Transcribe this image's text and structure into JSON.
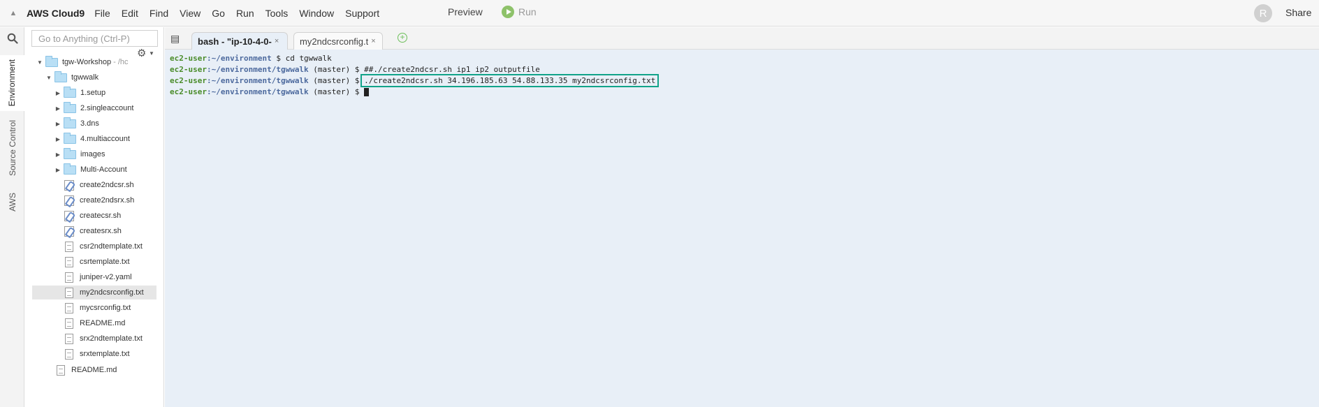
{
  "app": {
    "title": "AWS Cloud9",
    "menu": [
      "File",
      "Edit",
      "Find",
      "View",
      "Go",
      "Run",
      "Tools",
      "Window",
      "Support"
    ],
    "preview_label": "Preview",
    "run_label": "Run",
    "avatar_initial": "R",
    "share_label": "Share"
  },
  "rail": {
    "tabs": [
      "Environment",
      "Source Control",
      "AWS"
    ]
  },
  "tree": {
    "search_placeholder": "Go to Anything (Ctrl-P)",
    "root": {
      "name": "tgw-Workshop",
      "path_hint": "- /hc"
    },
    "folder": "tgwwalk",
    "subfolders": [
      "1.setup",
      "2.singleaccount",
      "3.dns",
      "4.multiaccount",
      "images",
      "Multi-Account"
    ],
    "scripts": [
      "create2ndcsr.sh",
      "create2ndsrx.sh",
      "createcsr.sh",
      "createsrx.sh"
    ],
    "files": [
      "csr2ndtemplate.txt",
      "csrtemplate.txt",
      "juniper-v2.yaml",
      "my2ndcsrconfig.txt",
      "mycsrconfig.txt",
      "README.md",
      "srx2ndtemplate.txt",
      "srxtemplate.txt"
    ],
    "root_file": "README.md",
    "selected_file": "my2ndcsrconfig.txt"
  },
  "editor": {
    "tabs": [
      {
        "label": "bash - \"ip-10-4-0-",
        "close": "×"
      },
      {
        "label": "my2ndcsrconfig.t",
        "close": "×"
      }
    ],
    "add_tab": "+"
  },
  "terminal": {
    "user": "ec2-user",
    "lines": [
      {
        "path": ":~/environment",
        "branch": "",
        "cmd": " $ cd tgwwalk"
      },
      {
        "path": ":~/environment/tgwwalk",
        "branch": " (master)",
        "cmd": " $ ##./create2ndcsr.sh ip1 ip2 outputfile"
      },
      {
        "path": ":~/environment/tgwwalk",
        "branch": " (master)",
        "cmd": " $ ./create2ndcsr.sh 34.196.185.63 54.88.133.35 my2ndcsrconfig.txt"
      },
      {
        "path": ":~/environment/tgwwalk",
        "branch": " (master)",
        "cmd": " $ "
      }
    ]
  }
}
